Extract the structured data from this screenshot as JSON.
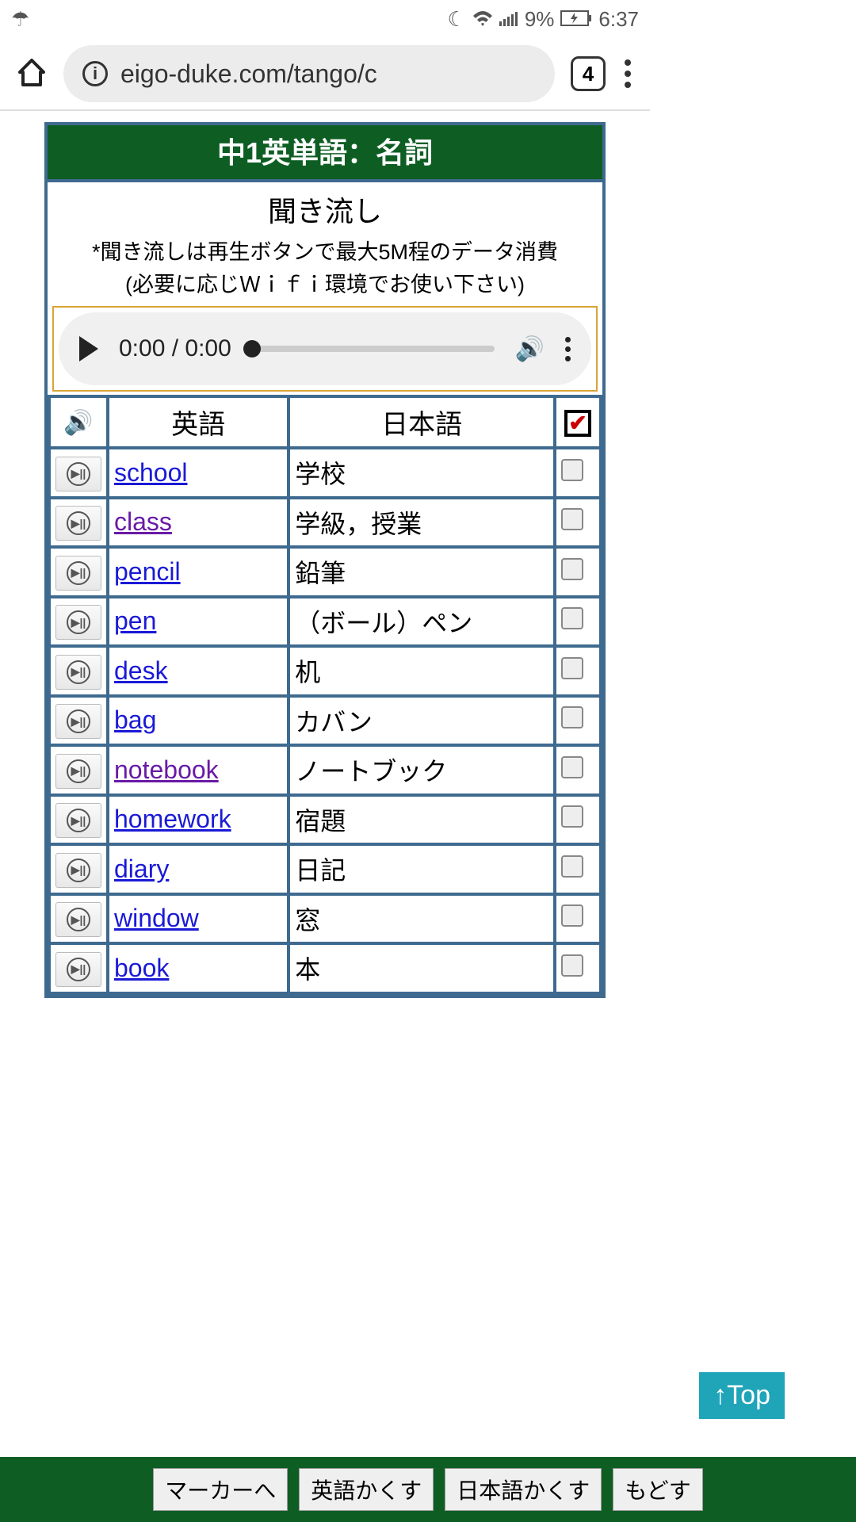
{
  "status": {
    "battery_pct": "9%",
    "time": "6:37"
  },
  "browser": {
    "url": "eigo-duke.com/tango/c",
    "tab_count": "4"
  },
  "page": {
    "title": "中1英単語：名詞",
    "subtitle": "聞き流し",
    "note1": "*聞き流しは再生ボタンで最大5M程のデータ消費",
    "note2": "(必要に応じＷｉｆｉ環境でお使い下さい)"
  },
  "audio": {
    "time": "0:00 / 0:00"
  },
  "table": {
    "head_en": "英語",
    "head_ja": "日本語",
    "rows": [
      {
        "en": "school",
        "ja": "学校",
        "visited": false
      },
      {
        "en": "class",
        "ja": "学級，授業",
        "visited": true
      },
      {
        "en": "pencil",
        "ja": "鉛筆",
        "visited": false
      },
      {
        "en": "pen",
        "ja": "（ボール）ペン",
        "visited": false
      },
      {
        "en": "desk",
        "ja": "机",
        "visited": false
      },
      {
        "en": "bag",
        "ja": "カバン",
        "visited": false
      },
      {
        "en": "notebook",
        "ja": "ノートブック",
        "visited": true
      },
      {
        "en": "homework",
        "ja": "宿題",
        "visited": false
      },
      {
        "en": "diary",
        "ja": "日記",
        "visited": false
      },
      {
        "en": "window",
        "ja": "窓",
        "visited": false
      },
      {
        "en": "book",
        "ja": "本",
        "visited": false
      }
    ]
  },
  "top_button": "↑Top",
  "bottom_buttons": {
    "marker": "マーカーへ",
    "hide_en": "英語かくす",
    "hide_ja": "日本語かくす",
    "reset": "もどす"
  }
}
